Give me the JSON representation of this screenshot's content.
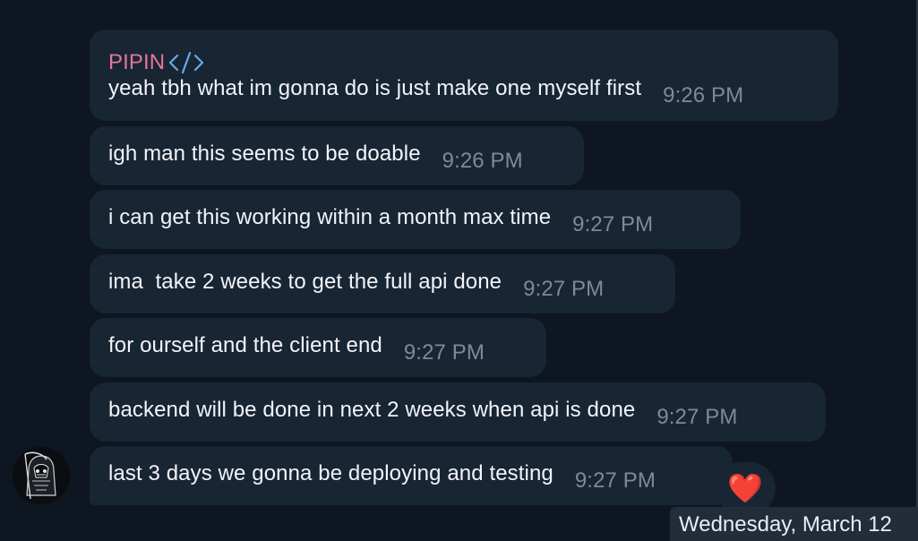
{
  "chat": {
    "sender": {
      "name": "PIPIN",
      "icon": "code-icon",
      "name_color": "#e4759b",
      "icon_color": "#6aa9e8"
    },
    "messages": [
      {
        "text": "yeah tbh what im gonna do is just make one myself first",
        "time": "9:26 PM"
      },
      {
        "text": "igh man this seems to be doable",
        "time": "9:26 PM"
      },
      {
        "text": "i can get this working within a month max time",
        "time": "9:27 PM"
      },
      {
        "text": "ima  take 2 weeks to get the full api done",
        "time": "9:27 PM"
      },
      {
        "text": "for ourself and the client end",
        "time": "9:27 PM"
      },
      {
        "text": "backend will be done in next 2 weeks when api is done",
        "time": "9:27 PM"
      },
      {
        "text": "last 3 days we gonna be deploying and testing",
        "time": "9:27 PM",
        "reaction": "❤️"
      }
    ],
    "avatar": {
      "icon": "reaper-avatar-icon"
    },
    "date_separator": "Wednesday, March 12"
  },
  "colors": {
    "background": "#0e1621",
    "bubble": "#182533",
    "text": "#f1f4f8",
    "time": "#7d8b99"
  }
}
